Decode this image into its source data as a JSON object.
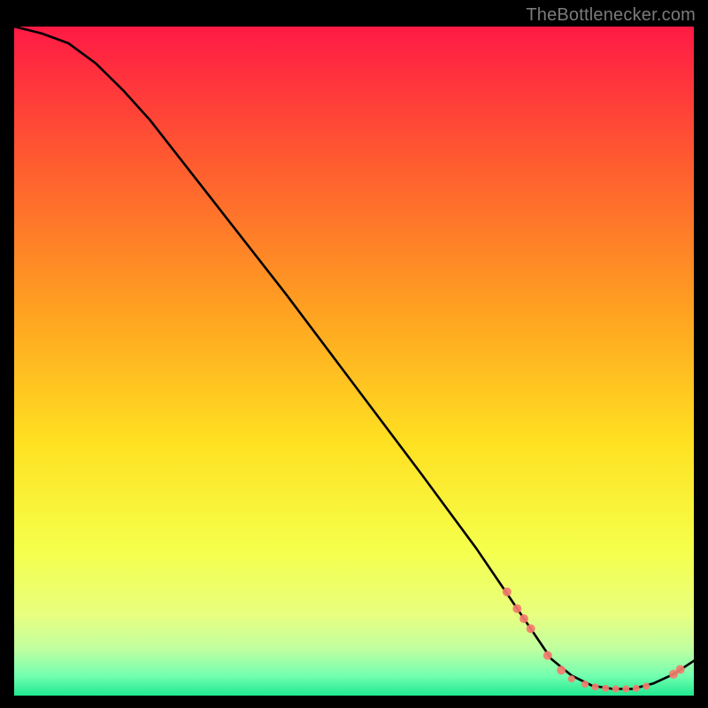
{
  "watermark": "TheBottlenecker.com",
  "colors": {
    "gradient": [
      {
        "offset": 0.0,
        "color": "#ff1a45"
      },
      {
        "offset": 0.2,
        "color": "#ff5a30"
      },
      {
        "offset": 0.42,
        "color": "#ffa021"
      },
      {
        "offset": 0.62,
        "color": "#ffe021"
      },
      {
        "offset": 0.78,
        "color": "#f5ff4a"
      },
      {
        "offset": 0.88,
        "color": "#e8ff80"
      },
      {
        "offset": 0.93,
        "color": "#c0ffa0"
      },
      {
        "offset": 0.97,
        "color": "#74ffb0"
      },
      {
        "offset": 1.0,
        "color": "#20e890"
      }
    ],
    "line": "#000000",
    "marker": "#f47c6d"
  },
  "chart_data": {
    "type": "line",
    "title": "",
    "xlabel": "",
    "ylabel": "",
    "xlim": [
      0,
      100
    ],
    "ylim": [
      0,
      100
    ],
    "series": [
      {
        "name": "bottleneck-curve",
        "x": [
          0,
          4,
          8,
          12,
          16,
          20,
          30,
          40,
          50,
          60,
          68,
          72,
          76,
          79,
          82,
          85,
          88,
          91,
          94,
          97,
          100
        ],
        "y": [
          100,
          99,
          97.5,
          94.5,
          90.5,
          86,
          73,
          60,
          46.5,
          33,
          22,
          16,
          10,
          5.5,
          3,
          1.5,
          1,
          1,
          1.8,
          3.2,
          5.2
        ]
      }
    ],
    "markers": [
      {
        "x": 72.5,
        "y": 15.5,
        "r": 5
      },
      {
        "x": 74.0,
        "y": 13.0,
        "r": 5
      },
      {
        "x": 75.0,
        "y": 11.5,
        "r": 5
      },
      {
        "x": 76.0,
        "y": 10.0,
        "r": 5
      },
      {
        "x": 78.5,
        "y": 6.0,
        "r": 5
      },
      {
        "x": 80.5,
        "y": 3.8,
        "r": 5
      },
      {
        "x": 82.0,
        "y": 2.5,
        "r": 4
      },
      {
        "x": 84.0,
        "y": 1.7,
        "r": 4
      },
      {
        "x": 85.5,
        "y": 1.3,
        "r": 4
      },
      {
        "x": 87.0,
        "y": 1.1,
        "r": 4
      },
      {
        "x": 88.5,
        "y": 1.0,
        "r": 4
      },
      {
        "x": 90.0,
        "y": 1.0,
        "r": 4
      },
      {
        "x": 91.5,
        "y": 1.1,
        "r": 4
      },
      {
        "x": 93.0,
        "y": 1.4,
        "r": 4
      },
      {
        "x": 97.0,
        "y": 3.2,
        "r": 5
      },
      {
        "x": 98.0,
        "y": 3.9,
        "r": 5
      }
    ]
  }
}
